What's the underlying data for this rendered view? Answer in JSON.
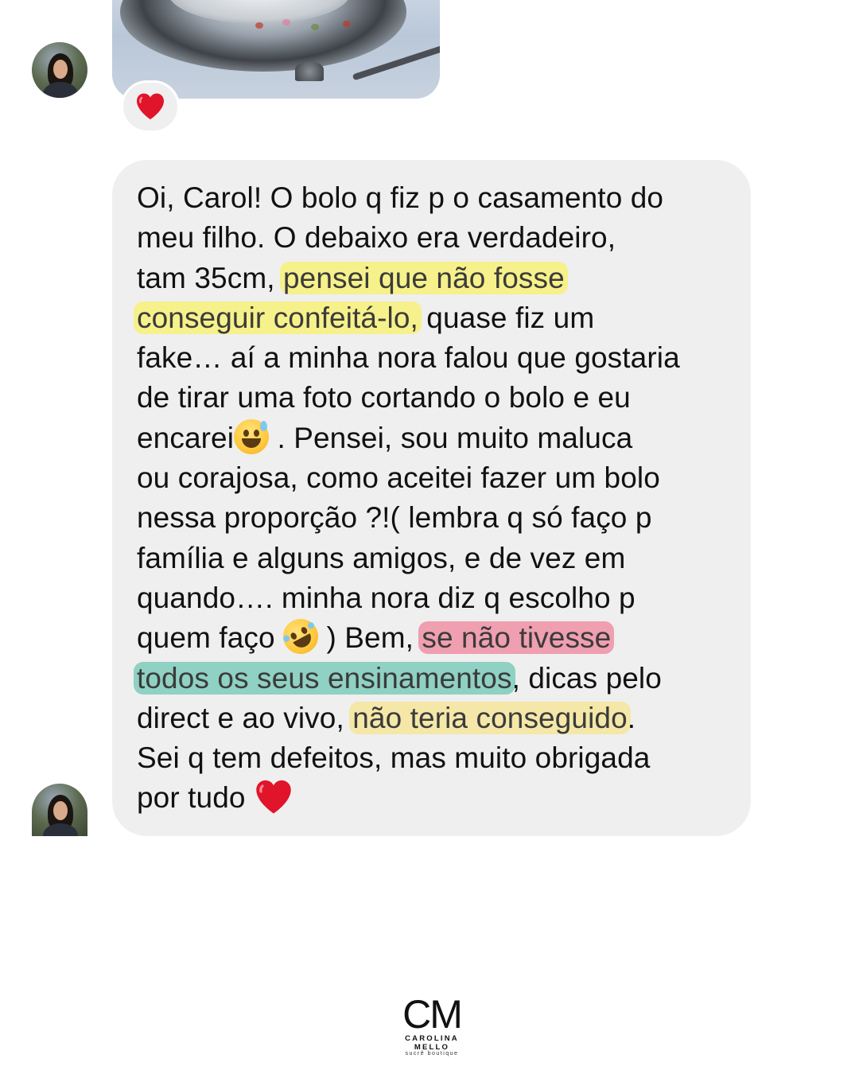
{
  "conversation": {
    "photo_message": {
      "reaction_icon": "red-heart-icon"
    },
    "text_message": {
      "lines": [
        [
          {
            "t": "Oi, Carol! O bolo q fiz p o casamento do"
          }
        ],
        [
          {
            "t": "meu filho. O debaixo era verdadeiro,"
          }
        ],
        [
          {
            "t": "tam 35cm, "
          },
          {
            "t": "pensei que não fosse",
            "hl": "yellow"
          }
        ],
        [
          {
            "t": "conseguir confeitá-lo,",
            "hl": "yellow"
          },
          {
            "t": " quase fiz um"
          }
        ],
        [
          {
            "t": "fake… aí a minha nora falou que gostaria"
          }
        ],
        [
          {
            "t": "de tirar uma foto cortando o bolo e eu"
          }
        ],
        [
          {
            "t": "encarei"
          },
          {
            "emoji": "grinning-sweat"
          },
          {
            "t": " . Pensei, sou muito maluca"
          }
        ],
        [
          {
            "t": "ou corajosa, como aceitei fazer um bolo"
          }
        ],
        [
          {
            "t": "nessa proporção ?!( lembra q só faço p"
          }
        ],
        [
          {
            "t": "família e alguns amigos, e de vez em"
          }
        ],
        [
          {
            "t": "quando…. minha nora diz q escolho p"
          }
        ],
        [
          {
            "t": "quem faço "
          },
          {
            "emoji": "rofl"
          },
          {
            "t": " ) Bem, "
          },
          {
            "t": "se não tivesse",
            "hl": "pink"
          }
        ],
        [
          {
            "t": "todos os seus ensinamentos",
            "hl": "teal"
          },
          {
            "t": ", dicas pelo"
          }
        ],
        [
          {
            "t": "direct e ao vivo, "
          },
          {
            "t": "não teria conseguido",
            "hl": "cream"
          },
          {
            "t": "."
          }
        ],
        [
          {
            "t": "Sei q tem defeitos, mas muito obrigada"
          }
        ],
        [
          {
            "t": "por tudo "
          },
          {
            "emoji": "red-heart"
          }
        ]
      ]
    }
  },
  "brand": {
    "monogram": "CM",
    "name": "CAROLINA MELLO",
    "tagline": "sucrê boutique"
  }
}
